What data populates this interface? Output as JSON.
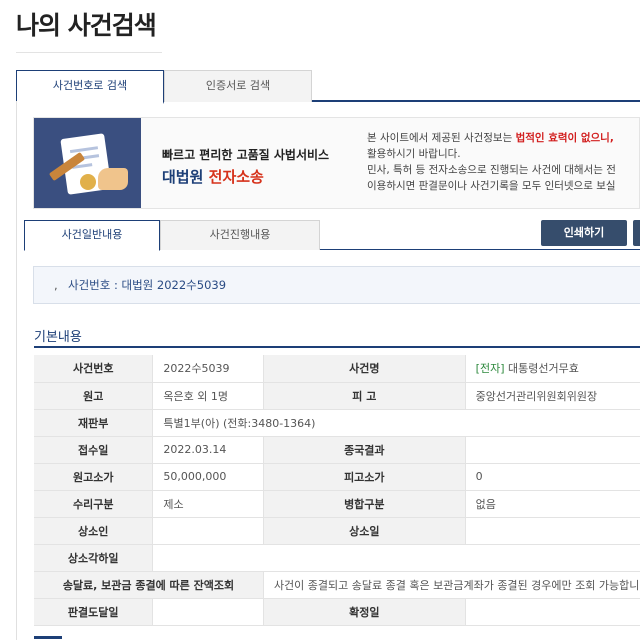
{
  "page": {
    "title": "나의 사건검색"
  },
  "top_tabs": [
    {
      "label": "사건번호로 검색",
      "active": true
    },
    {
      "label": "인증서로 검색",
      "active": false
    }
  ],
  "banner": {
    "line1": "빠르고 편리한 고품질 사법서비스",
    "brand": "대법원",
    "brand_red": "전자소송",
    "right_line1_a": "본 사이트에서 제공된 사건정보는 ",
    "right_line1_red": "법적인 효력이 없으니,",
    "right_line2": "활용하시기 바랍니다.",
    "right_line3": "민사, 특허 등 전자소송으로 진행되는 사건에 대해서는 전",
    "right_line4": "이용하시면 판결문이나 사건기록을 모두 인터넷으로 보실"
  },
  "sub_tabs": [
    {
      "label": "사건일반내용",
      "active": true
    },
    {
      "label": "사건진행내용",
      "active": false
    }
  ],
  "buttons": {
    "print": "인쇄하기"
  },
  "case_box": {
    "bullet": ",",
    "text": "사건번호 : 대법원 2022수5039"
  },
  "section": {
    "title": "기본내용"
  },
  "table": {
    "case_no_label": "사건번호",
    "case_no": "2022수5039",
    "case_name_label": "사건명",
    "case_name_tag": "[전자]",
    "case_name": " 대통령선거무효",
    "plaintiff_label": "원고",
    "plaintiff": "옥은호 외 1명",
    "defendant_label": "피 고",
    "defendant": "중앙선거관리위원회위원장",
    "court_label": "재판부",
    "court": "특별1부(아) (전화:3480-1364)",
    "filed_label": "접수일",
    "filed": "2022.03.14",
    "result_label": "종국결과",
    "result": "",
    "p_amount_label": "원고소가",
    "p_amount": "50,000,000",
    "d_amount_label": "피고소가",
    "d_amount": "0",
    "accept_label": "수리구분",
    "accept": "제소",
    "merge_label": "병합구분",
    "merge": "없음",
    "appellant_label": "상소인",
    "appellant": "",
    "appeal_date_label": "상소일",
    "appeal_date": "",
    "appeal_reject_label": "상소각하일",
    "appeal_reject": "",
    "balance_label": "송달료, 보관금 종결에 따른 잔액조회",
    "balance": "사건이 종결되고 송달료 종결 혹은 보관금계좌가 종결된 경우에만 조회 가능합니다.",
    "delivery_label": "판결도달일",
    "delivery": "",
    "final_label": "확정일",
    "final": ""
  }
}
